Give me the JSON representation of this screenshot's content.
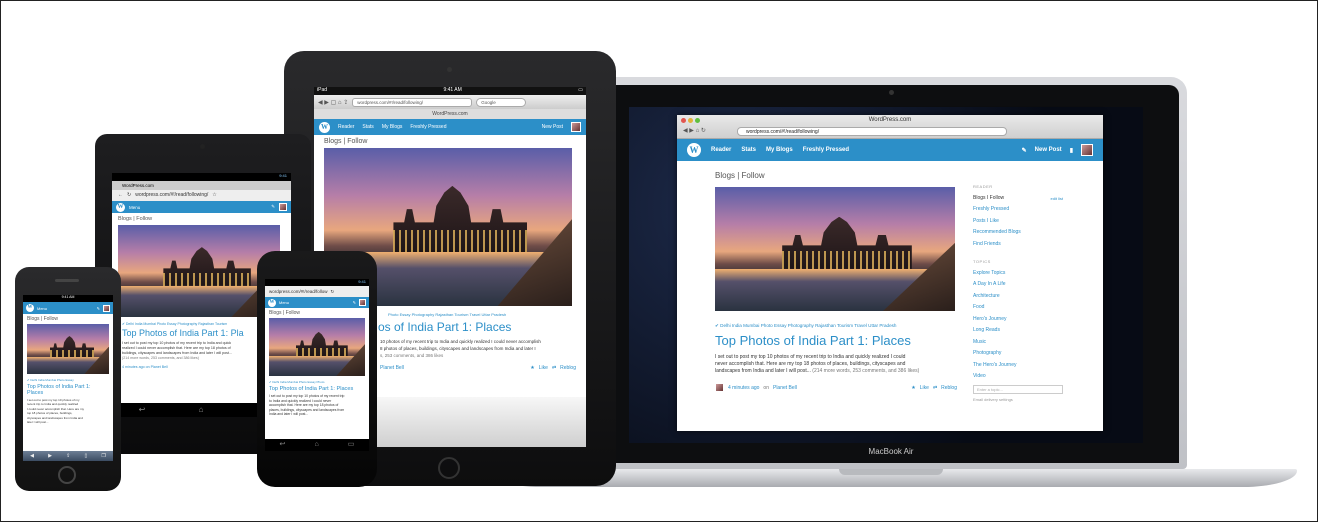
{
  "laptop": {
    "label": "MacBook Air",
    "window_title": "WordPress.com",
    "url": "wordpress.com/#!/read/following/",
    "nav": [
      "Reader",
      "Stats",
      "My Blogs",
      "Freshly Pressed"
    ],
    "new_post": "New Post",
    "breadcrumb": "Blogs | Follow",
    "tags": "✔ Delhi  India  Mumbai  Photo Essay  Photography  Rajasthan  Tourism  Travel  Uttar Pradesh",
    "post_title": "Top Photos of India Part 1: Places",
    "excerpt_1": "I set out to post my top 10 photos of my recent trip to India and quickly realized I could",
    "excerpt_2": "never accomplish that. Here are my top 18 photos of places, buildings, cityscapes and",
    "excerpt_3": "landscapes from India and later I will post...",
    "excerpt_meta": "(214 more words, 253 comments, and 386 likes)",
    "byline_time": "4 minutes ago",
    "byline_on": "on",
    "byline_author": "Planet Bell",
    "like": "Like",
    "reblog": "Reblog",
    "sidebar": {
      "reader_head": "READER",
      "edit_list": "edit list",
      "items": [
        "Blogs I Follow",
        "Freshly Pressed",
        "Posts I Like",
        "Recommended Blogs",
        "Find Friends"
      ],
      "topics_head": "TOPICS",
      "topics": [
        "Explore Topics",
        "A Day In A Life",
        "Architecture",
        "Food",
        "Hero's Journey",
        "Long Reads",
        "Music",
        "Photography",
        "The Hero's Journey",
        "Video"
      ],
      "topic_placeholder": "Enter a topic...",
      "email_settings": "Email delivery settings"
    }
  },
  "ipad": {
    "status_left": "iPad",
    "status_time": "9:41 AM",
    "url": "wordpress.com/#!/read/following/",
    "search_placeholder": "Google",
    "page_title": "WordPress.com",
    "nav": [
      "Reader",
      "Stats",
      "My Blogs",
      "Freshly Pressed"
    ],
    "new_post": "New Post",
    "breadcrumb": "Blogs | Follow",
    "tags": "Photo Essay  Photography  Rajasthan  Tourism  Travel  Uttar Pradesh",
    "post_title": "os of India Part 1: Places",
    "excerpt_1": "10 photos of my recent trip to India and quickly realized I could never accomplish",
    "excerpt_2": "8 photos of places, buildings, cityscapes and landscapes from India and later I",
    "excerpt_3": "s, 253 comments, and 386 likes",
    "byline": "Planet Bell",
    "like": "Like",
    "reblog": "Reblog"
  },
  "tablet7": {
    "status_time": "9:41",
    "tab_title": "WordPress.com",
    "url": "wordpress.com/#!/read/following/",
    "menu": "Menu",
    "breadcrumb": "Blogs | Follow",
    "tags": "✔ Delhi  India  Mumbai  Photo Essay  Photography  Rajasthan  Tourism",
    "post_title": "Top Photos of India Part 1: Pla",
    "excerpt_1": "I set out to post my top 10 photos of my recent trip to India and quick",
    "excerpt_2": "realized I could never accomplish that. Here are my top 18 photos of",
    "excerpt_3": "buildings, cityscapes and landscapes from India and later I will post...",
    "excerpt_4": "(214 more words, 253 comments, and 386 likes)",
    "byline": "4 minutes ago on Planet Bell"
  },
  "nexus": {
    "status_time": "9:41",
    "url": "wordpress.com/#!/read/follow",
    "menu": "Menu",
    "breadcrumb": "Blogs | Follow",
    "tags": "✔ Delhi  India  Mumbai  Photo Essay  Photo",
    "post_title": "Top Photos of India Part 1: Places",
    "excerpt_1": "I set out to post my top 10 photos of my recent trip",
    "excerpt_2": "to India and quickly realized I could never",
    "excerpt_3": "accomplish that. Here are my top 18 photos of",
    "excerpt_4": "places, buildings, cityscapes and landscapes from",
    "excerpt_5": "India and later I will post..."
  },
  "iphone": {
    "status_time": "9:41 AM",
    "menu": "Menu",
    "breadcrumb": "Blogs | Follow",
    "tags": "✔ Delhi  India  Mumbai  Photo Essay",
    "post_title_1": "Top Photos of India Part 1:",
    "post_title_2": "Places",
    "excerpt_1": "I set out to post my top 10 photos of my",
    "excerpt_2": "recent trip to India and quickly realized",
    "excerpt_3": "I could never accomplish that. Here are my",
    "excerpt_4": "top 18 photos of places, buildings,",
    "excerpt_5": "cityscapes and landscapes from India and",
    "excerpt_6": "later I will post..."
  },
  "colors": {
    "wp_blue": "#2c8fc8",
    "stage_bg": "#ffffff"
  }
}
